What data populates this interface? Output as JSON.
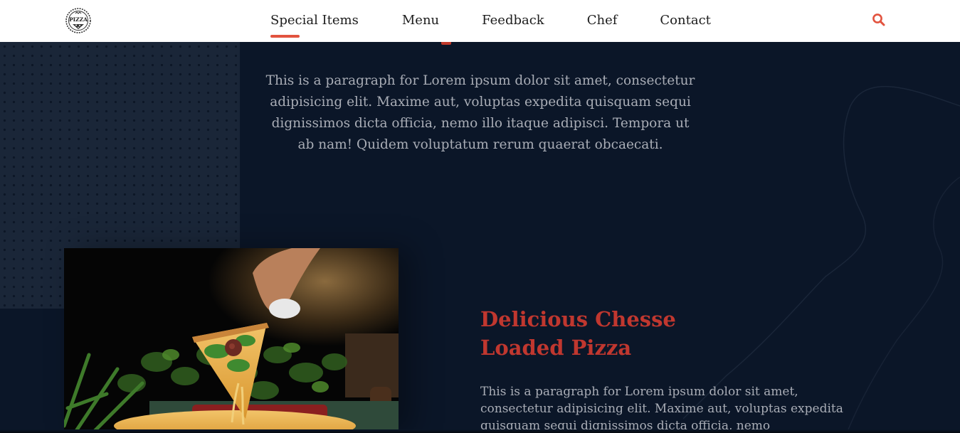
{
  "nav": {
    "logo_text": "PIZZA",
    "links": [
      {
        "label": "Special Items",
        "active": true
      },
      {
        "label": "Menu",
        "active": false
      },
      {
        "label": "Feedback",
        "active": false
      },
      {
        "label": "Chef",
        "active": false
      },
      {
        "label": "Contact",
        "active": false
      }
    ],
    "search_icon": "search-icon"
  },
  "intro": {
    "paragraph": "This is a paragraph for Lorem ipsum dolor sit amet, consectetur adipisicing elit. Maxime aut, voluptas expedita quisquam sequi dignissimos dicta officia, nemo illo itaque adipisci. Tempora ut ab nam! Quidem voluptatum rerum quaerat obcaecati."
  },
  "feature": {
    "title": "Delicious Chesse Loaded Pizza",
    "text": "This is a paragraph for Lorem ipsum dolor sit amet, consectetur adipisicing elit. Maxime aut, voluptas expedita quisquam sequi dignissimos dicta officia, nemo"
  },
  "colors": {
    "background": "#0b1628",
    "accent": "#e2533f",
    "title": "#c0372f",
    "text": "#a9adb6"
  }
}
